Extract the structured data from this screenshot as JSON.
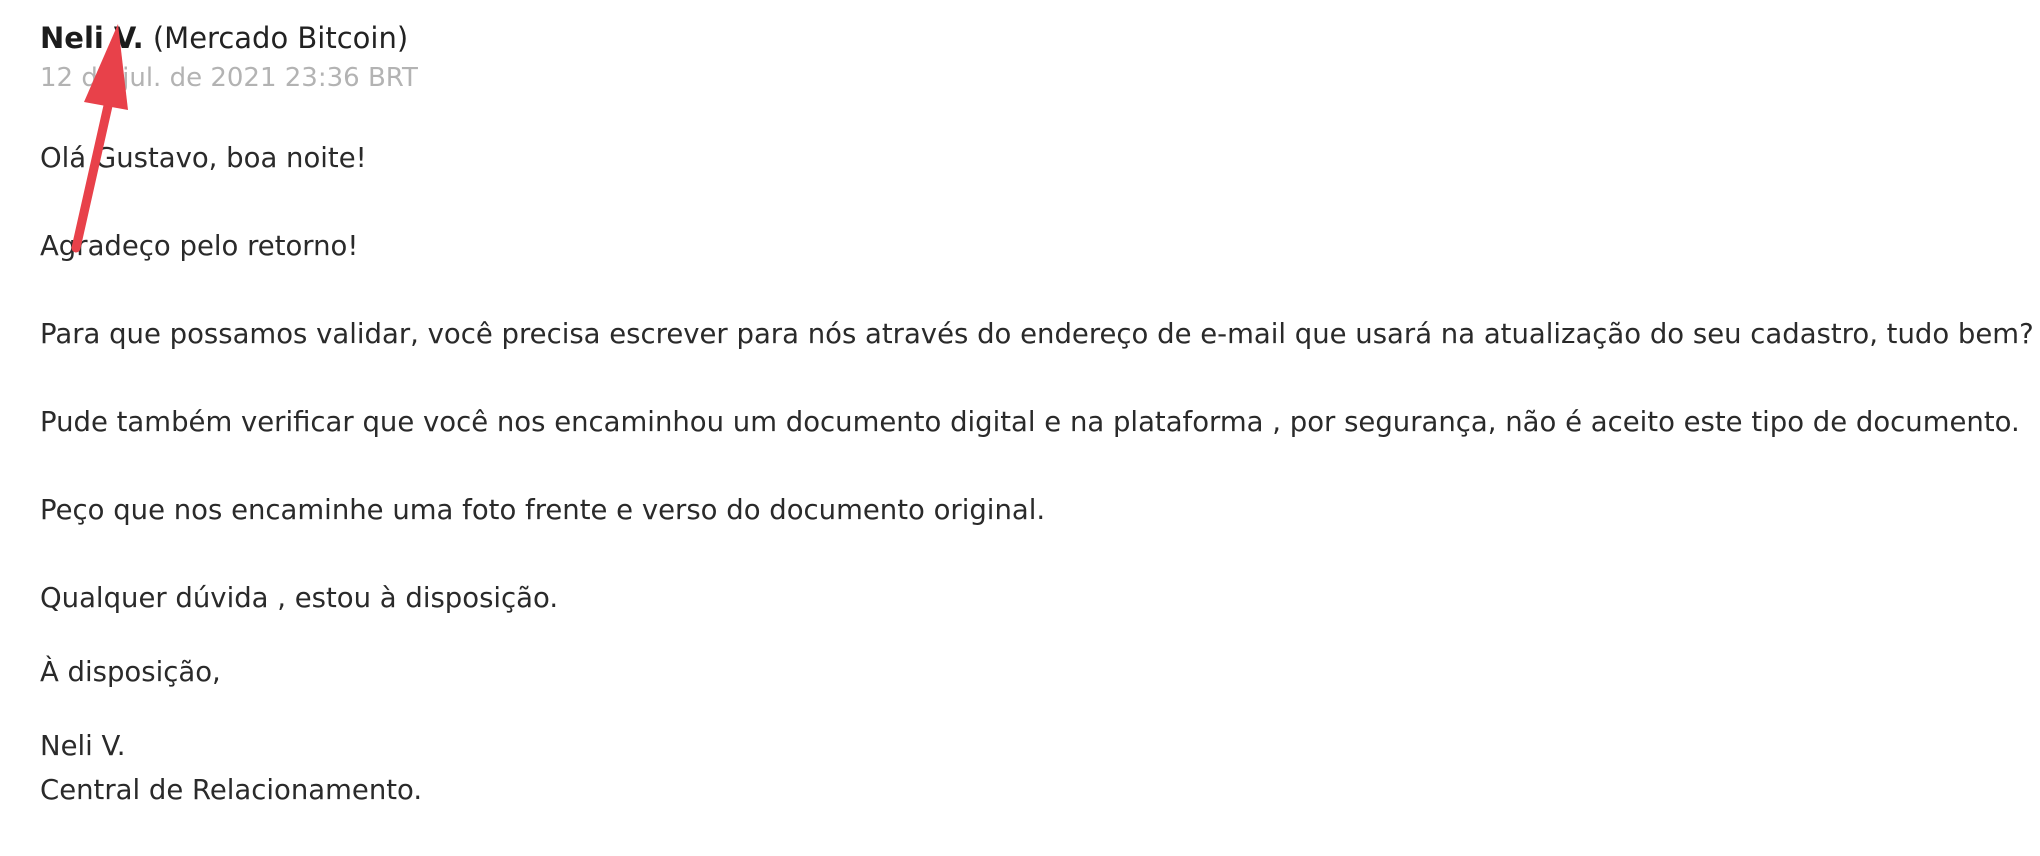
{
  "message": {
    "sender_name": "Neli V.",
    "sender_org": "(Mercado Bitcoin)",
    "timestamp": "12 de jul. de 2021 23:36 BRT",
    "paragraphs": [
      "Olá Gustavo, boa noite!",
      "Agradeço pelo retorno!",
      "Para que possamos validar, você precisa escrever para nós através do endereço de e-mail que usará na atualização do seu cadastro, tudo bem?",
      "Pude também verificar que você nos encaminhou um documento digital e na plataforma , por segurança, não é aceito este tipo de documento.",
      "Peço que nos encaminhe uma foto frente e verso do documento original.",
      "Qualquer dúvida , estou à disposição.",
      "À disposição,"
    ],
    "signature": {
      "name": "Neli V.",
      "department": "Central de Relacionamento."
    }
  },
  "annotation": {
    "arrow_color": "#e8414a"
  }
}
